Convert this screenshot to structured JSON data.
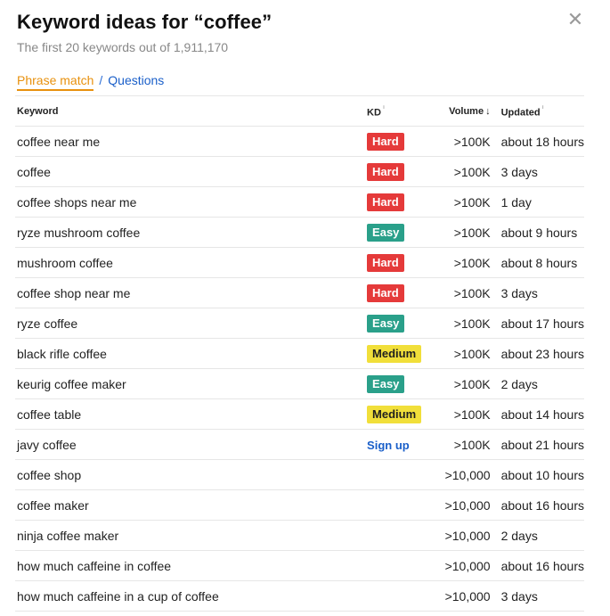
{
  "header": {
    "title": "Keyword ideas for “coffee”",
    "subtitle": "The first 20 keywords out of 1,911,170",
    "close_label": "✕"
  },
  "tabs": {
    "active": "Phrase match",
    "separator": "/",
    "other": "Questions"
  },
  "table": {
    "headers": {
      "keyword": "Keyword",
      "kd": "KD",
      "volume": "Volume",
      "volume_sort_arrow": "↓",
      "updated": "Updated",
      "info_glyph": "ⁱ"
    },
    "rows": [
      {
        "keyword": "coffee near me",
        "kd": "Hard",
        "kd_type": "hard",
        "volume": ">100K",
        "updated": "about 18 hours"
      },
      {
        "keyword": "coffee",
        "kd": "Hard",
        "kd_type": "hard",
        "volume": ">100K",
        "updated": "3 days"
      },
      {
        "keyword": "coffee shops near me",
        "kd": "Hard",
        "kd_type": "hard",
        "volume": ">100K",
        "updated": "1 day"
      },
      {
        "keyword": "ryze mushroom coffee",
        "kd": "Easy",
        "kd_type": "easy",
        "volume": ">100K",
        "updated": "about 9 hours"
      },
      {
        "keyword": "mushroom coffee",
        "kd": "Hard",
        "kd_type": "hard",
        "volume": ">100K",
        "updated": "about 8 hours"
      },
      {
        "keyword": "coffee shop near me",
        "kd": "Hard",
        "kd_type": "hard",
        "volume": ">100K",
        "updated": "3 days"
      },
      {
        "keyword": "ryze coffee",
        "kd": "Easy",
        "kd_type": "easy",
        "volume": ">100K",
        "updated": "about 17 hours"
      },
      {
        "keyword": "black rifle coffee",
        "kd": "Medium",
        "kd_type": "medium",
        "volume": ">100K",
        "updated": "about 23 hours"
      },
      {
        "keyword": "keurig coffee maker",
        "kd": "Easy",
        "kd_type": "easy",
        "volume": ">100K",
        "updated": "2 days"
      },
      {
        "keyword": "coffee table",
        "kd": "Medium",
        "kd_type": "medium",
        "volume": ">100K",
        "updated": "about 14 hours"
      },
      {
        "keyword": "javy coffee",
        "kd": "Sign up",
        "kd_type": "signup",
        "volume": ">100K",
        "updated": "about 21 hours"
      },
      {
        "keyword": "coffee shop",
        "kd": "",
        "kd_type": "none",
        "volume": ">10,000",
        "updated": "about 10 hours"
      },
      {
        "keyword": "coffee maker",
        "kd": "",
        "kd_type": "none",
        "volume": ">10,000",
        "updated": "about 16 hours"
      },
      {
        "keyword": "ninja coffee maker",
        "kd": "",
        "kd_type": "none",
        "volume": ">10,000",
        "updated": "2 days"
      },
      {
        "keyword": "how much caffeine in coffee",
        "kd": "",
        "kd_type": "none",
        "volume": ">10,000",
        "updated": "about 16 hours"
      },
      {
        "keyword": "how much caffeine in a cup of coffee",
        "kd": "",
        "kd_type": "none",
        "volume": ">10,000",
        "updated": "3 days"
      }
    ]
  },
  "colors": {
    "hard": "#e53a3a",
    "easy": "#2aa08a",
    "medium": "#f1df3a",
    "link": "#1a5fc9",
    "active_tab": "#e8910e"
  }
}
